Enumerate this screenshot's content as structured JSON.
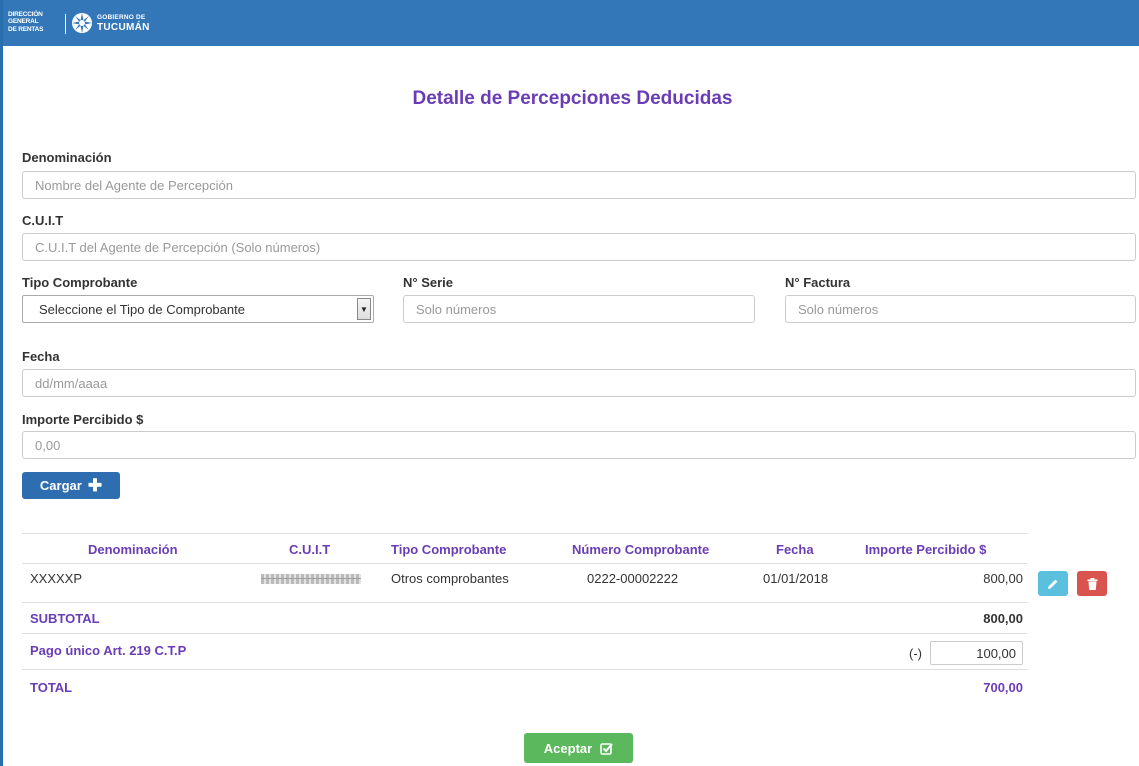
{
  "header": {
    "logo_dgr_lines": [
      "DIRECCIÓN",
      "GENERAL",
      "DE RENTAS"
    ],
    "logo_gob_line1": "GOBIERNO DE",
    "logo_gob_line2": "TUCUMÁN"
  },
  "colors": {
    "header_bg": "#3377b8",
    "accent_purple": "#6a3db5",
    "primary_button": "#2f6db1",
    "edit_button": "#5bc0de",
    "delete_button": "#d9534f",
    "accept_button": "#5cb85c"
  },
  "title": "Detalle de Percepciones Deducidas",
  "form": {
    "denominacion": {
      "label": "Denominación",
      "placeholder": "Nombre del Agente de Percepción",
      "value": ""
    },
    "cuit": {
      "label": "C.U.I.T",
      "placeholder": "C.U.I.T del Agente de Percepción (Solo números)",
      "value": ""
    },
    "tipo_comprobante": {
      "label": "Tipo Comprobante",
      "selected": "Seleccione el Tipo de Comprobante"
    },
    "nro_serie": {
      "label": "N° Serie",
      "placeholder": "Solo números",
      "value": ""
    },
    "nro_factura": {
      "label": "N° Factura",
      "placeholder": "Solo números",
      "value": ""
    },
    "fecha": {
      "label": "Fecha",
      "placeholder": "dd/mm/aaaa",
      "value": ""
    },
    "importe": {
      "label": "Importe Percibido $",
      "placeholder": "0,00",
      "value": ""
    },
    "cargar_label": "Cargar"
  },
  "table": {
    "headers": [
      "Denominación",
      "C.U.I.T",
      "Tipo Comprobante",
      "Número Comprobante",
      "Fecha",
      "Importe Percibido $"
    ],
    "rows": [
      {
        "denominacion": "XXXXXP",
        "cuit": "",
        "tipo": "Otros comprobantes",
        "numero": "0222-00002222",
        "fecha": "01/01/2018",
        "importe": "800,00"
      }
    ],
    "subtotal_label": "SUBTOTAL",
    "subtotal_value": "800,00",
    "pago_label": "Pago único Art. 219 C.T.P",
    "pago_sign": "(-)",
    "pago_value": "100,00",
    "total_label": "TOTAL",
    "total_value": "700,00"
  },
  "aceptar_label": "Aceptar"
}
